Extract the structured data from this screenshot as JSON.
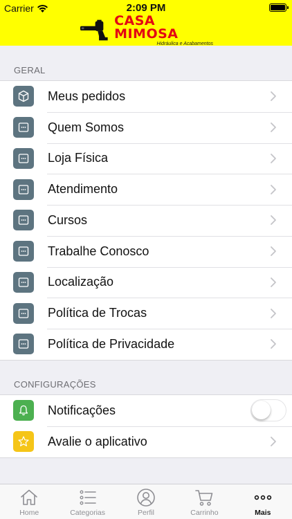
{
  "status_bar": {
    "carrier": "Carrier",
    "time": "2:09 PM"
  },
  "brand": {
    "name": "CASA MIMOSA",
    "tagline": "Hidráulica e Acabamentos",
    "accent": "#ffff00",
    "name_color": "#e30613"
  },
  "sections": {
    "geral": {
      "title": "GERAL",
      "items": [
        {
          "label": "Meus pedidos",
          "icon": "package-icon"
        },
        {
          "label": "Quem Somos",
          "icon": "page-icon"
        },
        {
          "label": "Loja Física",
          "icon": "page-icon"
        },
        {
          "label": "Atendimento",
          "icon": "page-icon"
        },
        {
          "label": "Cursos",
          "icon": "page-icon"
        },
        {
          "label": "Trabalhe Conosco",
          "icon": "page-icon"
        },
        {
          "label": "Localização",
          "icon": "page-icon"
        },
        {
          "label": "Política de Trocas",
          "icon": "page-icon"
        },
        {
          "label": "Política de Privacidade",
          "icon": "page-icon"
        }
      ]
    },
    "configuracoes": {
      "title": "CONFIGURAÇÕES",
      "items": [
        {
          "label": "Notificações",
          "icon": "bell-icon",
          "toggle": false
        },
        {
          "label": "Avalie o aplicativo",
          "icon": "star-icon"
        }
      ]
    }
  },
  "tabbar": {
    "tabs": [
      {
        "label": "Home",
        "icon": "home-icon"
      },
      {
        "label": "Categorias",
        "icon": "list-icon"
      },
      {
        "label": "Perfil",
        "icon": "user-icon"
      },
      {
        "label": "Carrinho",
        "icon": "cart-icon"
      },
      {
        "label": "Mais",
        "icon": "more-icon",
        "active": true
      }
    ]
  }
}
